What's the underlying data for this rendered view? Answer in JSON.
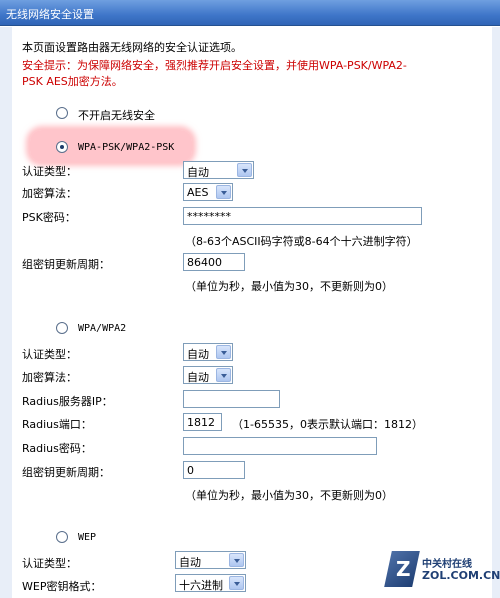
{
  "window": {
    "title": "无线网络安全设置"
  },
  "intro": {
    "line1": "本页面设置路由器无线网络的安全认证选项。",
    "warning_line1": "安全提示：为保障网络安全，强烈推荐开启安全设置，并使用WPA-PSK/WPA2-",
    "warning_line2": "PSK AES加密方法。"
  },
  "no_security": {
    "label": "不开启无线安全",
    "selected": false
  },
  "wpa_psk": {
    "label": "WPA-PSK/WPA2-PSK",
    "selected": true,
    "auth_type_label": "认证类型：",
    "auth_type_value": "自动",
    "encryption_label": "加密算法：",
    "encryption_value": "AES",
    "psk_label": "PSK密码：",
    "psk_value": "********",
    "psk_hint": "（8-63个ASCII码字符或8-64个十六进制字符）",
    "group_key_label": "组密钥更新周期：",
    "group_key_value": "86400",
    "group_key_hint": "（单位为秒，最小值为30，不更新则为0）"
  },
  "wpa_enterprise": {
    "label": "WPA/WPA2",
    "selected": false,
    "auth_type_label": "认证类型：",
    "auth_type_value": "自动",
    "encryption_label": "加密算法：",
    "encryption_value": "自动",
    "radius_ip_label": "Radius服务器IP：",
    "radius_ip_value": "",
    "radius_port_label": "Radius端口：",
    "radius_port_value": "1812",
    "radius_port_hint": "（1-65535，0表示默认端口：1812）",
    "radius_password_label": "Radius密码：",
    "radius_password_value": "",
    "group_key_label": "组密钥更新周期：",
    "group_key_value": "0",
    "group_key_hint": "（单位为秒，最小值为30，不更新则为0）"
  },
  "wep": {
    "label": "WEP",
    "selected": false,
    "auth_type_label": "认证类型：",
    "auth_type_value": "自动",
    "key_format_label": "WEP密钥格式：",
    "key_format_value": "十六进制"
  },
  "watermark": {
    "cn": "中关村在线",
    "en": "ZOL.COM.CN",
    "mark": "Z"
  },
  "colors": {
    "titlebar": "#3f76c9",
    "warning": "#cc0000",
    "highlight": "#ff96a0"
  }
}
